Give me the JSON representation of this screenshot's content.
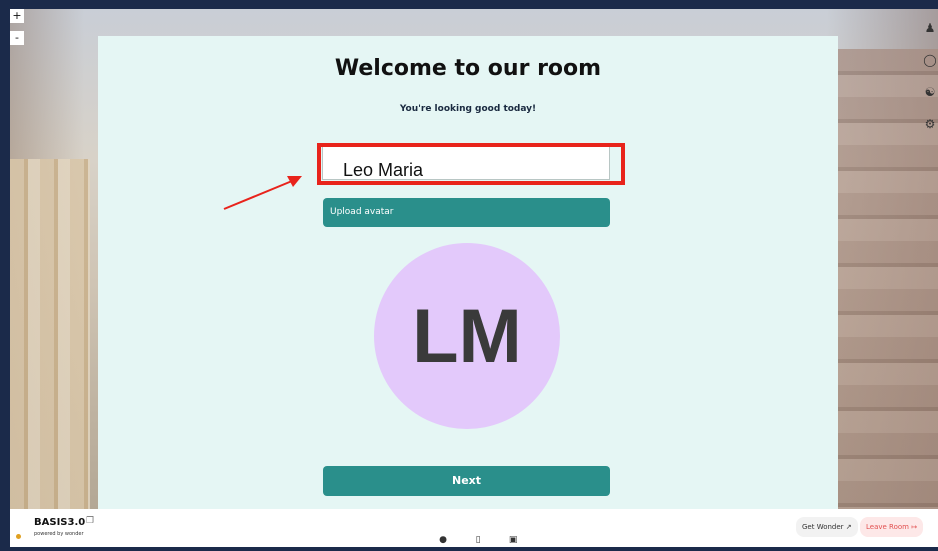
{
  "controls": {
    "zoom_in": "+",
    "zoom_out": "-"
  },
  "sidebar": {
    "icons": [
      "people-icon",
      "search-icon",
      "sitemap-icon",
      "gear-icon"
    ]
  },
  "modal": {
    "title": "Welcome to our room",
    "subtitle": "You're looking good today!",
    "name_value": "Leo Maria",
    "upload_label": "Upload avatar",
    "avatar_initials": "LM",
    "avatar_color": "#e3c9fb",
    "next_label": "Next",
    "accent_color": "#2a8f8b",
    "highlight_color": "#e8231b"
  },
  "bottom_bar": {
    "brand_name": "BASIS3.0",
    "brand_sub": "powered by wonder",
    "center_icons": [
      "mic-icon",
      "camera-icon",
      "screen-share-icon"
    ],
    "get_wonder_label": "Get Wonder",
    "leave_room_label": "Leave Room"
  }
}
